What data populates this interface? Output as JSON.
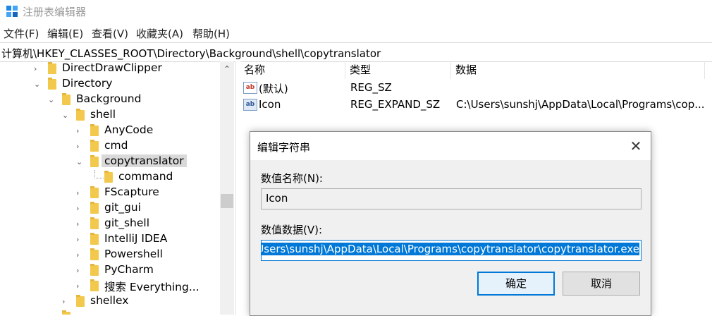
{
  "window": {
    "title": "注册表编辑器"
  },
  "menu": [
    "文件(F)",
    "编辑(E)",
    "查看(V)",
    "收藏夹(A)",
    "帮助(H)"
  ],
  "address": "计算机\\HKEY_CLASSES_ROOT\\Directory\\Background\\shell\\copytranslator",
  "tree": [
    {
      "label": "DirectDrawClipper",
      "chevron": ">"
    },
    {
      "label": "Directory",
      "chevron": "v"
    },
    {
      "label": "Background",
      "chevron": "v"
    },
    {
      "label": "shell",
      "chevron": "v"
    },
    {
      "label": "AnyCode",
      "chevron": ">"
    },
    {
      "label": "cmd",
      "chevron": ">"
    },
    {
      "label": "copytranslator",
      "chevron": "v"
    },
    {
      "label": "command",
      "chevron": ""
    },
    {
      "label": "FScapture",
      "chevron": ">"
    },
    {
      "label": "git_gui",
      "chevron": ">"
    },
    {
      "label": "git_shell",
      "chevron": ">"
    },
    {
      "label": "IntelliJ IDEA",
      "chevron": ">"
    },
    {
      "label": "Powershell",
      "chevron": ">"
    },
    {
      "label": "PyCharm",
      "chevron": ">"
    },
    {
      "label": "搜索 Everything...",
      "chevron": ">"
    },
    {
      "label": "shellex",
      "chevron": ">"
    }
  ],
  "list": {
    "headers": [
      "名称",
      "类型",
      "数据"
    ],
    "rows": [
      {
        "icon": "ab",
        "name": "(默认)",
        "type": "REG_SZ",
        "data": ""
      },
      {
        "icon": "ab",
        "name": "Icon",
        "type": "REG_EXPAND_SZ",
        "data": "C:\\Users\\sunshj\\AppData\\Local\\Programs\\cop..."
      }
    ]
  },
  "dialog": {
    "title": "编辑字符串",
    "close_glyph": "✕",
    "name_label": "数值名称(N):",
    "name_value": "Icon",
    "data_label": "数值数据(V):",
    "data_value": "C:\\Users\\sunshj\\AppData\\Local\\Programs\\copytranslator\\copytranslator.exe",
    "ok": "确定",
    "cancel": "取消"
  }
}
